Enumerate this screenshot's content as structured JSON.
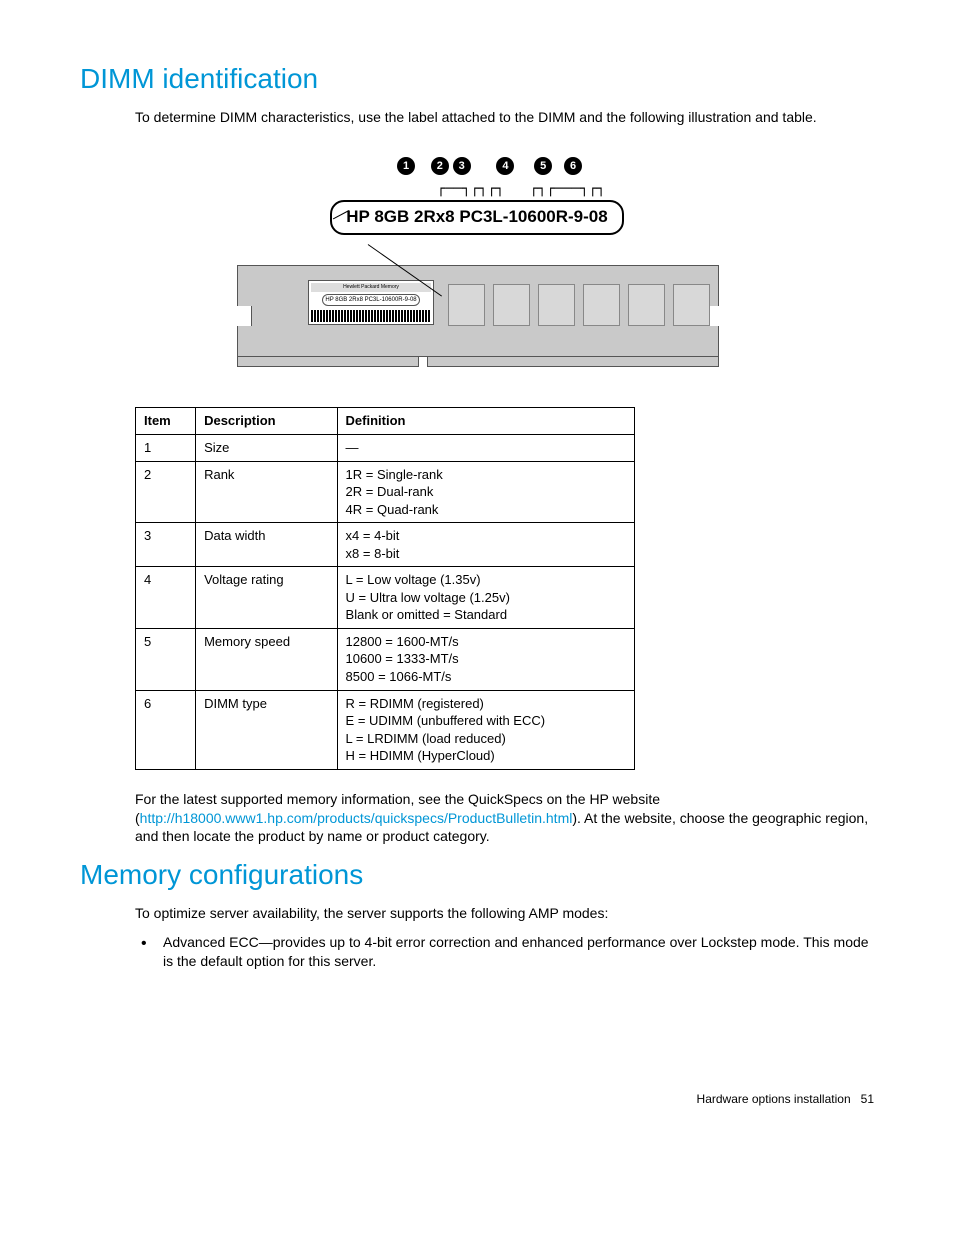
{
  "section1": {
    "title": "DIMM identification",
    "intro": "To determine DIMM characteristics, use the label attached to the DIMM and the following illustration and table.",
    "label_text": "HP 8GB 2Rx8 PC3L-10600R-9-08",
    "callouts": [
      "1",
      "2",
      "3",
      "4",
      "5",
      "6"
    ],
    "sticker_line1": "Hewlett Packard Memory",
    "sticker_line2": "HP 8GB 2Rx8 PC3L-10600R-9-08"
  },
  "table": {
    "headers": [
      "Item",
      "Description",
      "Definition"
    ],
    "rows": [
      {
        "item": "1",
        "desc": "Size",
        "def": "—"
      },
      {
        "item": "2",
        "desc": "Rank",
        "def": "1R = Single-rank\n2R = Dual-rank\n4R = Quad-rank"
      },
      {
        "item": "3",
        "desc": "Data width",
        "def": "x4 = 4-bit\nx8 = 8-bit"
      },
      {
        "item": "4",
        "desc": "Voltage rating",
        "def": "L = Low voltage (1.35v)\nU = Ultra low voltage (1.25v)\nBlank or omitted = Standard"
      },
      {
        "item": "5",
        "desc": "Memory speed",
        "def": "12800 = 1600-MT/s\n10600 = 1333-MT/s\n8500 = 1066-MT/s"
      },
      {
        "item": "6",
        "desc": "DIMM type",
        "def": "R = RDIMM (registered)\nE = UDIMM (unbuffered with ECC)\nL = LRDIMM (load reduced)\nH = HDIMM (HyperCloud)"
      }
    ]
  },
  "post_table": {
    "pre": "For the latest supported memory information, see the QuickSpecs on the HP website (",
    "link": "http://h18000.www1.hp.com/products/quickspecs/ProductBulletin.html",
    "post": "). At the website, choose the geographic region, and then locate the product by name or product category."
  },
  "section2": {
    "title": "Memory configurations",
    "intro": "To optimize server availability, the server supports the following AMP modes:",
    "bullets": [
      "Advanced ECC—provides up to 4-bit error correction and enhanced performance over Lockstep mode. This mode is the default option for this server."
    ]
  },
  "footer": {
    "text": "Hardware options installation",
    "page": "51"
  }
}
